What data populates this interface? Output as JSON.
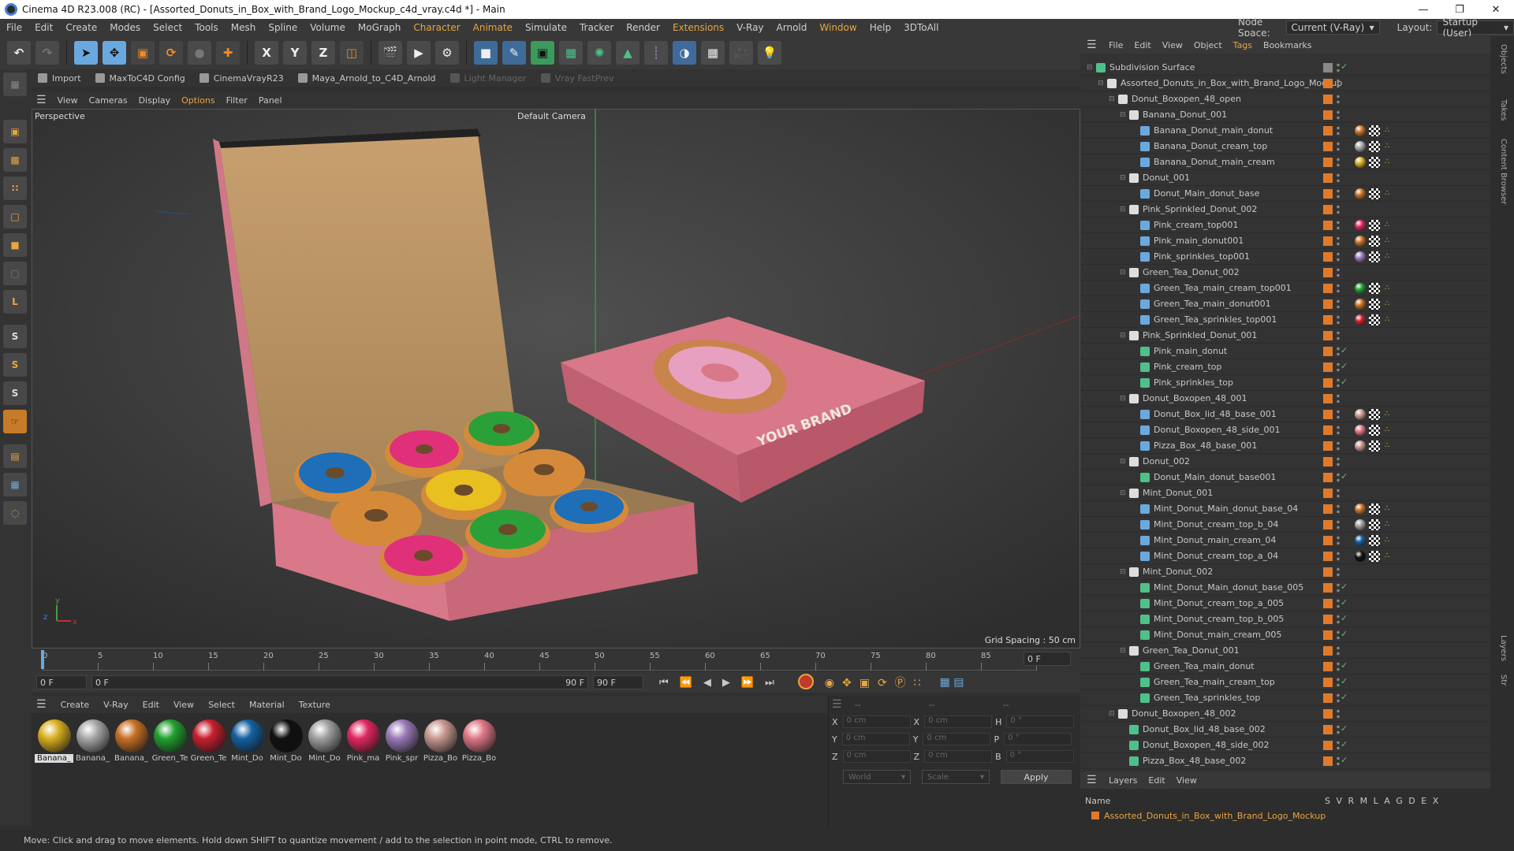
{
  "window": {
    "title": "Cinema 4D R23.008 (RC) - [Assorted_Donuts_in_Box_with_Brand_Logo_Mockup_c4d_vray.c4d *] - Main"
  },
  "menubar": [
    "File",
    "Edit",
    "Create",
    "Modes",
    "Select",
    "Tools",
    "Mesh",
    "Spline",
    "Volume",
    "MoGraph",
    "Character",
    "Animate",
    "Simulate",
    "Tracker",
    "Render",
    "Extensions",
    "V-Ray",
    "Arnold",
    "Window",
    "Help",
    "3DToAll"
  ],
  "nodespace": {
    "label": "Node Space:",
    "value": "Current (V-Ray)",
    "layout_label": "Layout:",
    "layout_value": "Startup (User)"
  },
  "plugins": {
    "import": "Import",
    "maxtoc4d": "MaxToC4D Config",
    "cinemavray": "CinemaVrayR23",
    "maya_arnold": "Maya_Arnold_to_C4D_Arnold",
    "light_manager": "Light Manager",
    "vray_fastprev": "Vray FastPrev"
  },
  "viewport_menu": [
    "View",
    "Cameras",
    "Display",
    "Options",
    "Filter",
    "Panel"
  ],
  "viewport": {
    "label": "Perspective",
    "camera": "Default Camera",
    "grid_spacing": "Grid Spacing : 50 cm",
    "brand_text": "YOUR BRAND"
  },
  "timeline": {
    "ticks": [
      "0",
      "5",
      "10",
      "15",
      "20",
      "25",
      "30",
      "35",
      "40",
      "45",
      "50",
      "55",
      "60",
      "65",
      "70",
      "75",
      "80",
      "85",
      "90"
    ],
    "current_frame": "0 F"
  },
  "transport": {
    "start": "0 F",
    "current": "0 F",
    "end1": "90 F",
    "end2": "90 F"
  },
  "material_menu": [
    "Create",
    "V-Ray",
    "Edit",
    "View",
    "Select",
    "Material",
    "Texture"
  ],
  "materials": [
    {
      "name": "Banana_",
      "color": "#d9b020"
    },
    {
      "name": "Banana_",
      "color": "#a8a8a8"
    },
    {
      "name": "Banana_",
      "color": "#c87025"
    },
    {
      "name": "Green_Te",
      "color": "#22a030"
    },
    {
      "name": "Green_Te",
      "color": "#c8202e"
    },
    {
      "name": "Mint_Do",
      "color": "#1560a0"
    },
    {
      "name": "Mint_Do",
      "color": "#101010"
    },
    {
      "name": "Mint_Do",
      "color": "#a0a0a0"
    },
    {
      "name": "Pink_ma",
      "color": "#e02860"
    },
    {
      "name": "Pink_spr",
      "color": "#9a7ab8"
    },
    {
      "name": "Pizza_Bo",
      "color": "#c89890"
    },
    {
      "name": "Pizza_Bo",
      "color": "#e07888"
    }
  ],
  "coords": {
    "x_pos": "0 cm",
    "y_pos": "0 cm",
    "z_pos": "0 cm",
    "x_size": "0 cm",
    "y_size": "0 cm",
    "z_size": "0 cm",
    "h": "0 °",
    "p": "0 °",
    "b": "0 °",
    "world": "World",
    "scale": "Scale",
    "apply": "Apply",
    "dash1": "--",
    "dash2": "--",
    "dash3": "--"
  },
  "status": "Move: Click and drag to move elements. Hold down SHIFT to quantize movement / add to the selection in point mode, CTRL to remove.",
  "objects_menu": [
    "File",
    "Edit",
    "View",
    "Object",
    "Tags",
    "Bookmarks"
  ],
  "objects": [
    {
      "name": "Subdivision Surface",
      "indent": 0,
      "type": "subd",
      "check": true
    },
    {
      "name": "Assorted_Donuts_in_Box_with_Brand_Logo_Mockup",
      "indent": 1,
      "type": "null"
    },
    {
      "name": "Donut_Boxopen_48_open",
      "indent": 2,
      "type": "null"
    },
    {
      "name": "Banana_Donut_001",
      "indent": 3,
      "type": "null"
    },
    {
      "name": "Banana_Donut_main_donut",
      "indent": 4,
      "type": "obj",
      "tag": "#c87025"
    },
    {
      "name": "Banana_Donut_cream_top",
      "indent": 4,
      "type": "obj",
      "tag": "#a8a8a8"
    },
    {
      "name": "Banana_Donut_main_cream",
      "indent": 4,
      "type": "obj",
      "tag": "#d9b020"
    },
    {
      "name": "Donut_001",
      "indent": 3,
      "type": "null"
    },
    {
      "name": "Donut_Main_donut_base",
      "indent": 4,
      "type": "obj",
      "tag": "#c87025"
    },
    {
      "name": "Pink_Sprinkled_Donut_002",
      "indent": 3,
      "type": "null"
    },
    {
      "name": "Pink_cream_top001",
      "indent": 4,
      "type": "obj",
      "tag": "#e02860"
    },
    {
      "name": "Pink_main_donut001",
      "indent": 4,
      "type": "obj",
      "tag": "#c87025"
    },
    {
      "name": "Pink_sprinkles_top001",
      "indent": 4,
      "type": "obj",
      "tag": "#9a7ab8"
    },
    {
      "name": "Green_Tea_Donut_002",
      "indent": 3,
      "type": "null"
    },
    {
      "name": "Green_Tea_main_cream_top001",
      "indent": 4,
      "type": "obj",
      "tag": "#22a030"
    },
    {
      "name": "Green_Tea_main_donut001",
      "indent": 4,
      "type": "obj",
      "tag": "#c87025"
    },
    {
      "name": "Green_Tea_sprinkles_top001",
      "indent": 4,
      "type": "obj",
      "tag": "#c8202e"
    },
    {
      "name": "Pink_Sprinkled_Donut_001",
      "indent": 3,
      "type": "null"
    },
    {
      "name": "Pink_main_donut",
      "indent": 4,
      "type": "poly",
      "check": true
    },
    {
      "name": "Pink_cream_top",
      "indent": 4,
      "type": "poly",
      "check": true
    },
    {
      "name": "Pink_sprinkles_top",
      "indent": 4,
      "type": "poly",
      "check": true
    },
    {
      "name": "Donut_Boxopen_48_001",
      "indent": 3,
      "type": "null"
    },
    {
      "name": "Donut_Box_lid_48_base_001",
      "indent": 4,
      "type": "obj",
      "tag": "#c89890"
    },
    {
      "name": "Donut_Boxopen_48_side_001",
      "indent": 4,
      "type": "obj",
      "tag": "#e07888"
    },
    {
      "name": "Pizza_Box_48_base_001",
      "indent": 4,
      "type": "obj",
      "tag": "#c89890"
    },
    {
      "name": "Donut_002",
      "indent": 3,
      "type": "null"
    },
    {
      "name": "Donut_Main_donut_base001",
      "indent": 4,
      "type": "poly",
      "check": true
    },
    {
      "name": "Mint_Donut_001",
      "indent": 3,
      "type": "null"
    },
    {
      "name": "Mint_Donut_Main_donut_base_04",
      "indent": 4,
      "type": "obj",
      "tag": "#c87025"
    },
    {
      "name": "Mint_Donut_cream_top_b_04",
      "indent": 4,
      "type": "obj",
      "tag": "#a0a0a0"
    },
    {
      "name": "Mint_Donut_main_cream_04",
      "indent": 4,
      "type": "obj",
      "tag": "#1560a0"
    },
    {
      "name": "Mint_Donut_cream_top_a_04",
      "indent": 4,
      "type": "obj",
      "tag": "#101010"
    },
    {
      "name": "Mint_Donut_002",
      "indent": 3,
      "type": "null"
    },
    {
      "name": "Mint_Donut_Main_donut_base_005",
      "indent": 4,
      "type": "poly",
      "check": true
    },
    {
      "name": "Mint_Donut_cream_top_a_005",
      "indent": 4,
      "type": "poly",
      "check": true
    },
    {
      "name": "Mint_Donut_cream_top_b_005",
      "indent": 4,
      "type": "poly",
      "check": true
    },
    {
      "name": "Mint_Donut_main_cream_005",
      "indent": 4,
      "type": "poly",
      "check": true
    },
    {
      "name": "Green_Tea_Donut_001",
      "indent": 3,
      "type": "null"
    },
    {
      "name": "Green_Tea_main_donut",
      "indent": 4,
      "type": "poly",
      "check": true
    },
    {
      "name": "Green_Tea_main_cream_top",
      "indent": 4,
      "type": "poly",
      "check": true
    },
    {
      "name": "Green_Tea_sprinkles_top",
      "indent": 4,
      "type": "poly",
      "check": true
    },
    {
      "name": "Donut_Boxopen_48_002",
      "indent": 2,
      "type": "null"
    },
    {
      "name": "Donut_Box_lid_48_base_002",
      "indent": 3,
      "type": "poly",
      "check": true
    },
    {
      "name": "Donut_Boxopen_48_side_002",
      "indent": 3,
      "type": "poly",
      "check": true
    },
    {
      "name": "Pizza_Box_48_base_002",
      "indent": 3,
      "type": "poly",
      "check": true
    }
  ],
  "layers_menu": [
    "Layers",
    "Edit",
    "View"
  ],
  "layers": {
    "name_header": "Name",
    "cols": "S V R M L A G D E X",
    "row": "Assorted_Donuts_in_Box_with_Brand_Logo_Mockup"
  },
  "right_tabs": [
    "Objects",
    "Takes",
    "Content Browser",
    "Layers",
    "Str"
  ]
}
